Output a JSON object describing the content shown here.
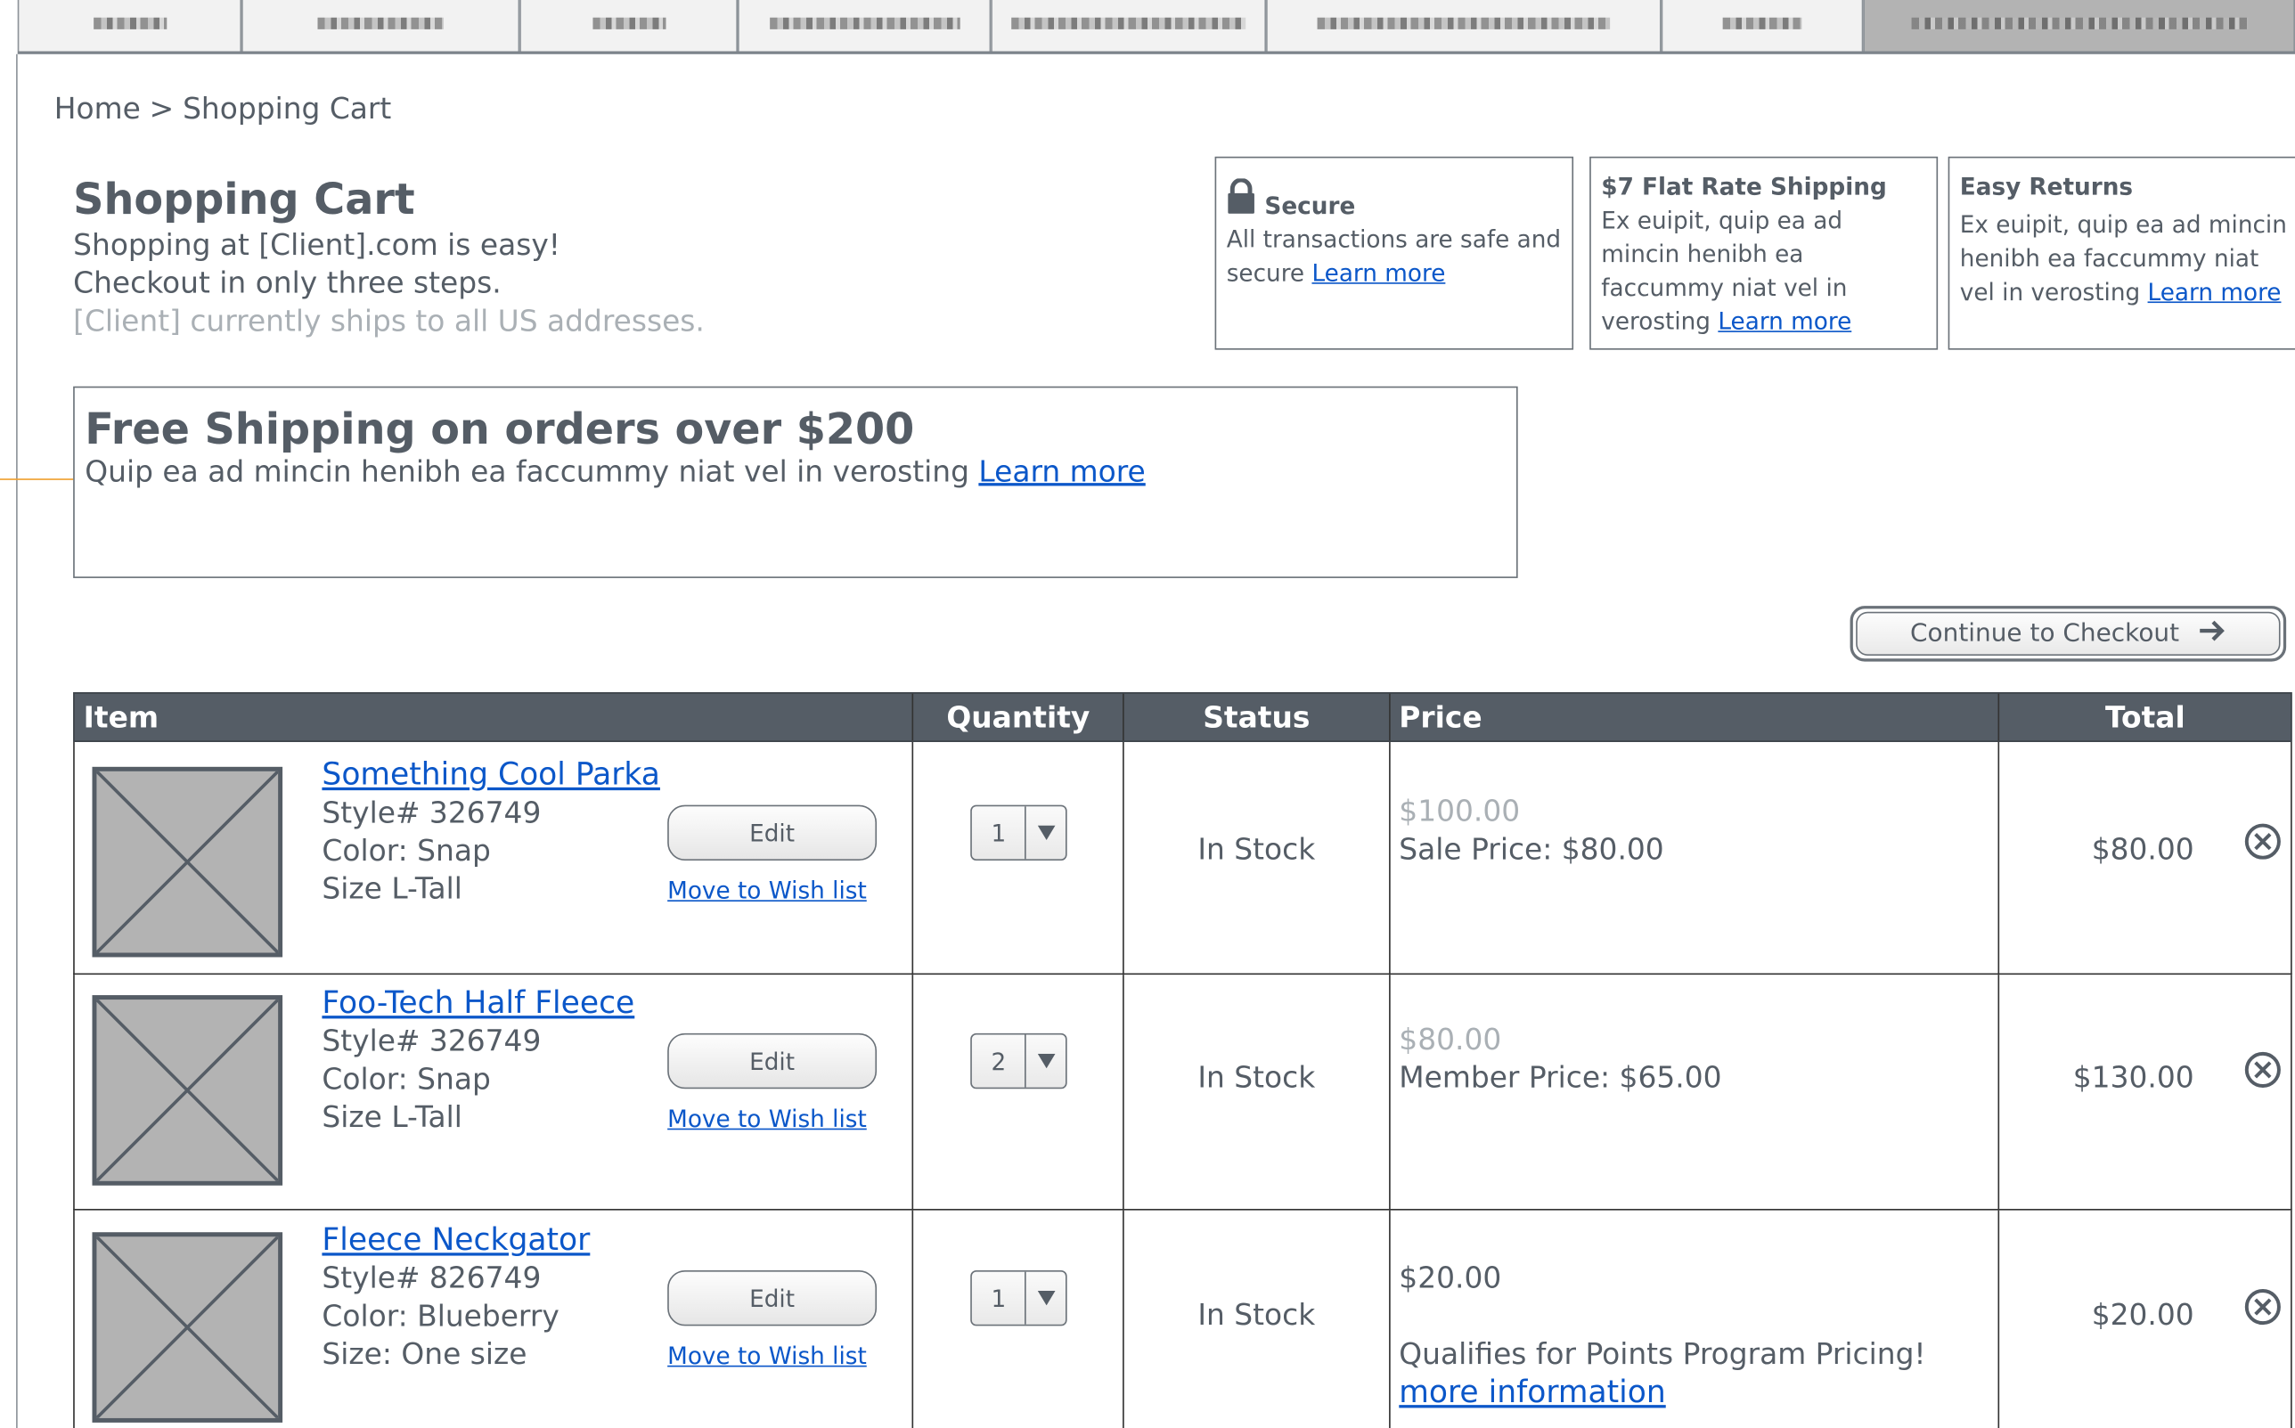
{
  "nav": {
    "tabs": [
      {
        "active": false
      },
      {
        "active": false
      },
      {
        "active": false
      },
      {
        "active": false
      },
      {
        "active": false
      },
      {
        "active": false
      },
      {
        "active": false
      },
      {
        "active": true
      }
    ]
  },
  "breadcrumb": {
    "home": "Home",
    "separator": ">",
    "current": "Shopping Cart"
  },
  "intro": {
    "title": "Shopping Cart",
    "line1": "Shopping at [Client].com is easy!",
    "line2": "Checkout in only three steps.",
    "note": "[Client] currently ships to all US addresses."
  },
  "info_boxes": {
    "secure": {
      "title": "Secure",
      "body": "All transactions are safe and secure",
      "link": "Learn more"
    },
    "shipping": {
      "title": "$7 Flat Rate Shipping",
      "body": "Ex euipit, quip ea ad mincin henibh ea faccummy niat vel in verosting",
      "link": "Learn more"
    },
    "returns": {
      "title": "Easy Returns",
      "body": "Ex euipit, quip ea ad mincin henibh ea faccummy niat vel in verosting",
      "link": "Learn more"
    }
  },
  "promo": {
    "title": "Free Shipping on orders over $200",
    "body": "Quip ea ad mincin henibh ea faccummy niat vel in verosting",
    "link": "Learn more"
  },
  "checkout": {
    "label": "Continue to Checkout",
    "icon": "arrow-right-icon"
  },
  "table": {
    "headers": {
      "item": "Item",
      "quantity": "Quantity",
      "status": "Status",
      "price": "Price",
      "total": "Total"
    },
    "rows": [
      {
        "name": "Something Cool Parka",
        "style": "Style# 326749",
        "color": "Color: Snap",
        "size": "Size L-Tall",
        "edit": "Edit",
        "wish": "Move to Wish list",
        "qty": "1",
        "status": "In Stock",
        "old_price": "$100.00",
        "price": "Sale Price: $80.00",
        "total": "$80.00"
      },
      {
        "name": "Foo-Tech Half Fleece",
        "style": "Style# 326749",
        "color": "Color: Snap",
        "size": "Size L-Tall",
        "edit": "Edit",
        "wish": "Move to Wish list",
        "qty": "2",
        "status": "In Stock",
        "old_price": "$80.00",
        "price": "Member Price: $65.00",
        "total": "$130.00"
      },
      {
        "name": "Fleece Neckgator",
        "style": "Style# 826749",
        "color": "Color: Blueberry",
        "size": "Size: One size",
        "edit": "Edit",
        "wish": "Move to Wish list",
        "qty": "1",
        "status": "In Stock",
        "price": "$20.00",
        "points_note": "Qualifies for Points Program Pricing!",
        "points_link": "more information",
        "total": "$20.00"
      }
    ]
  },
  "colors": {
    "text": "#555d66",
    "muted": "#aab0b5",
    "link": "#0b57c9",
    "header_bg": "#555d66",
    "placeholder": "#b3b3b3",
    "connector": "#f0a030"
  }
}
